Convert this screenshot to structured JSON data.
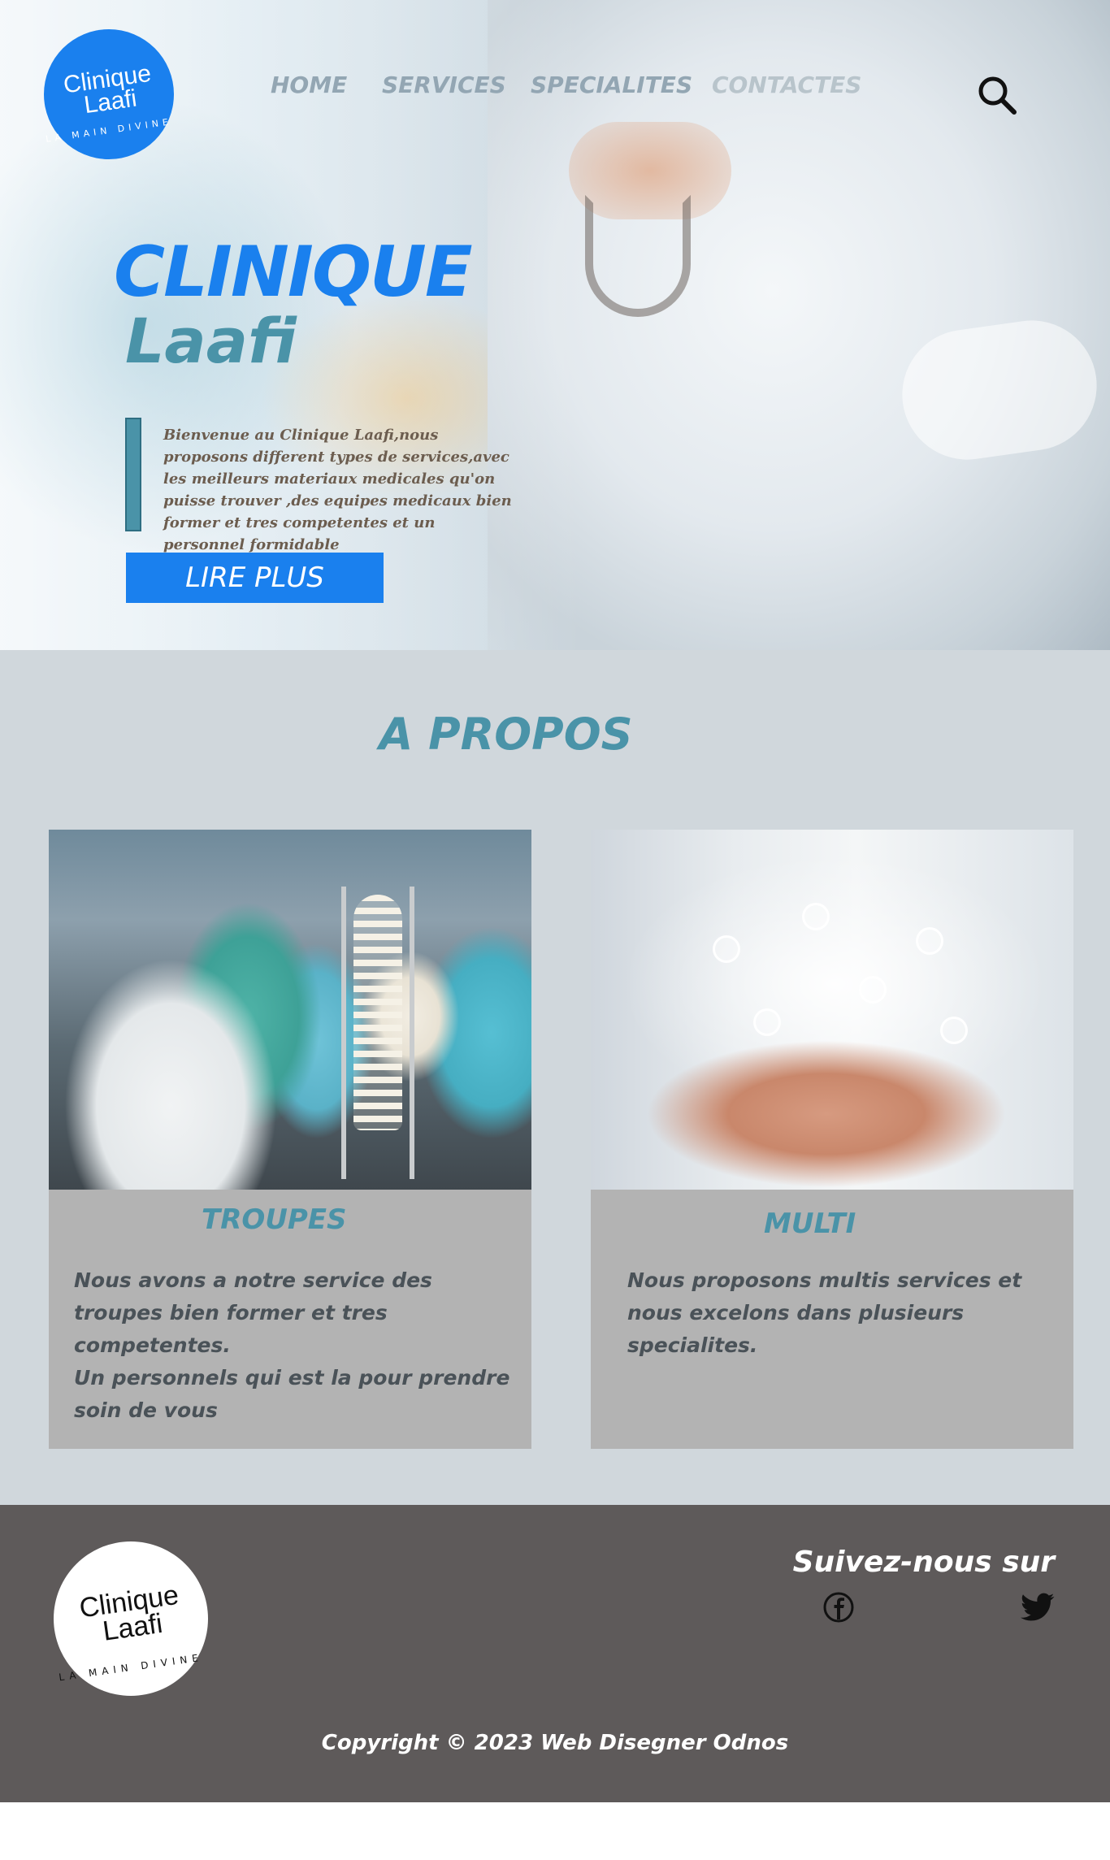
{
  "header": {
    "logo": {
      "line1": "Clinique",
      "line2": "Laafi",
      "tagline": "LA MAIN DIVINE"
    },
    "nav": {
      "home": "HOME",
      "services": "SERVICES",
      "specialites": "SPECIALITES",
      "contacts": "CONTACTES"
    },
    "search_icon": "search-icon"
  },
  "hero": {
    "title": "CLINIQUE",
    "subtitle": "Laafi",
    "description": "Bienvenue au Clinique Laafi,nous proposons different types de services,avec les meilleurs materiaux medicales qu'on puisse trouver ,des equipes medicaux bien former et tres competentes et un personnel formidable",
    "button": "LIRE PLUS"
  },
  "about": {
    "title": "A PROPOS",
    "cards": [
      {
        "title": "TROUPES",
        "text": "Nous avons a notre service des troupes bien former et tres competentes.\nUn personnels qui est la pour prendre soin de vous"
      },
      {
        "title": "MULTI",
        "text": "Nous proposons multis services et nous excelons dans plusieurs specialites."
      }
    ]
  },
  "footer": {
    "logo": {
      "line1": "Clinique",
      "line2": "Laafi",
      "tagline": "LA MAIN DIVINE"
    },
    "follow": "Suivez-nous sur",
    "social": [
      "facebook-icon",
      "twitter-icon"
    ],
    "copyright": "Copyright © 2023 Web Disegner Odnos"
  },
  "colors": {
    "accent": "#1a80ee",
    "teal": "#4a93a8",
    "about_bg": "#d0d7dc",
    "card_bg": "#b3b3b3",
    "footer_bg": "#5e5a5a"
  }
}
